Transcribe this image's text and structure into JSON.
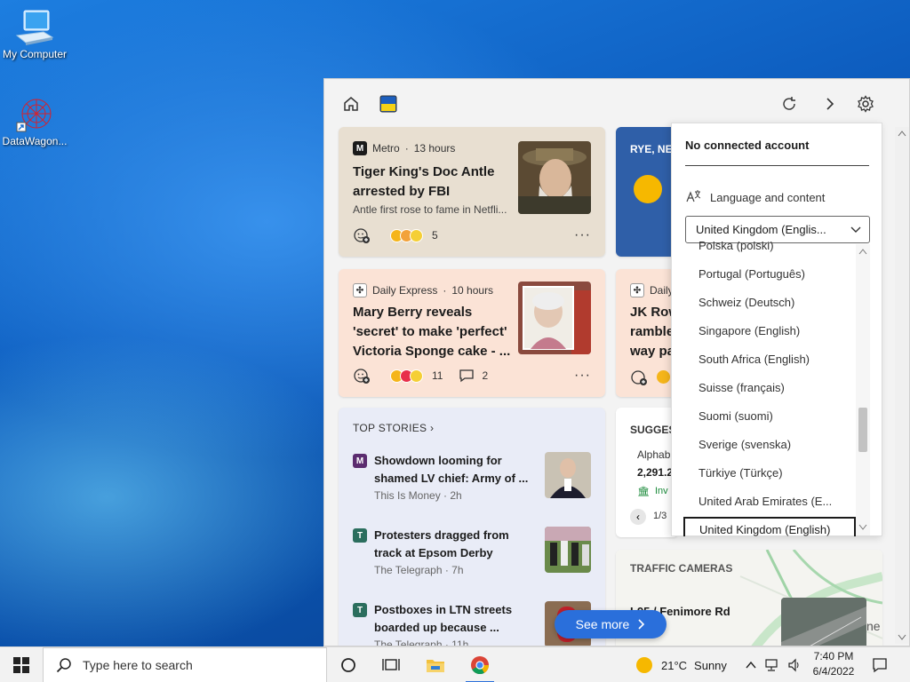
{
  "desktop": {
    "icons": [
      {
        "label": "My Computer",
        "icon": "computer-icon"
      },
      {
        "label": "DataWagon...",
        "icon": "datawagon-icon"
      }
    ]
  },
  "widgets": {
    "header": {
      "home_icon": "home-icon",
      "refresh_icon": "refresh-icon",
      "forward_icon": "chevron-right-icon",
      "settings_icon": "gear-icon"
    },
    "card_a": {
      "source": "Metro",
      "age": "13 hours",
      "headline": "Tiger King's Doc Antle arrested by FBI",
      "summary": "Antle first rose to fame in Netfli...",
      "reactions": "5"
    },
    "card_b": {
      "source": "Daily Express",
      "age": "10 hours",
      "headline": "Mary Berry reveals 'secret' to make 'perfect' Victoria Sponge cake - ...",
      "reactions": "11",
      "comments": "2"
    },
    "card_weather": {
      "location": "RYE, NE"
    },
    "card_c": {
      "source": "Daily",
      "headline": "JK Row\nramble\nway pa"
    },
    "top_stories": {
      "label": "TOP STORIES",
      "items": [
        {
          "title": "Showdown looming for shamed LV chief: Army of ...",
          "source": "This Is Money",
          "age": "2h",
          "logo": "M",
          "logo_color": "#5b2c6f"
        },
        {
          "title": "Protesters dragged from track at Epsom Derby",
          "source": "The Telegraph",
          "age": "7h",
          "logo": "T",
          "logo_color": "#2b6e5e"
        },
        {
          "title": "Postboxes in LTN streets boarded up because ...",
          "source": "The Telegraph",
          "age": "11h",
          "logo": "T",
          "logo_color": "#2b6e5e"
        }
      ]
    },
    "suggested": {
      "label": "SUGGES",
      "ticker": "Alphab",
      "value": "2,291.2",
      "invest": "Inv",
      "pager": "1/3"
    },
    "traffic": {
      "label": "TRAFFIC CAMERAS",
      "road": "I-95 / Fenimore Rd",
      "suffix": "ne"
    },
    "see_more": "See more"
  },
  "settings_flyout": {
    "account": "No connected account",
    "language_label": "Language and content",
    "selected": "United Kingdom (Englis...",
    "options": [
      "Polska (polski)",
      "Portugal (Português)",
      "Schweiz (Deutsch)",
      "Singapore (English)",
      "South Africa (English)",
      "Suisse (français)",
      "Suomi (suomi)",
      "Sverige (svenska)",
      "Türkiye (Türkçe)",
      "United Arab Emirates (E...",
      "United Kingdom (English)"
    ],
    "selected_index": 10
  },
  "taskbar": {
    "search_placeholder": "Type here to search",
    "weather_temp": "21°C",
    "weather_desc": "Sunny",
    "time": "7:40 PM",
    "date": "6/4/2022"
  },
  "colors": {
    "accent": "#2a6fdb",
    "panel_bg": "#f3f3f3",
    "card_beige": "#e8dfd1",
    "card_peach": "#fbe3d6",
    "weather_blue": "#2f5fa8"
  }
}
